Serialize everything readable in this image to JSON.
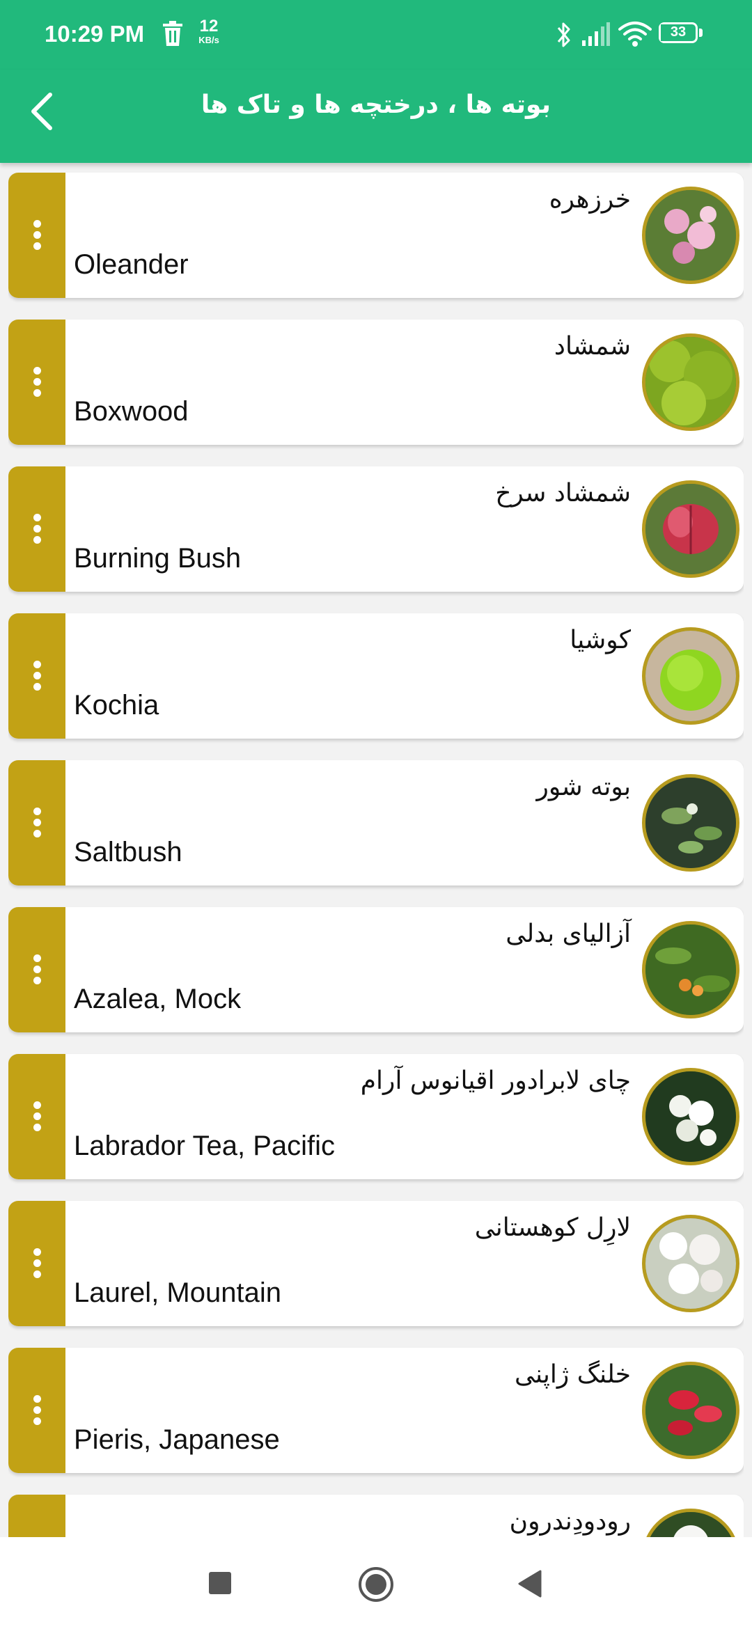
{
  "status": {
    "time": "10:29 PM",
    "netspeed_value": "12",
    "netspeed_unit": "KB/s",
    "battery": "33",
    "battery_fraction": 0.33
  },
  "header": {
    "title": "بوته ها ، درختچه ها و تاک ها",
    "back_icon": "chevron-left-icon"
  },
  "colors": {
    "primary": "#21b97c",
    "menu_strip": "#c2a215",
    "thumb_border": "#b79b1f"
  },
  "items": [
    {
      "fa": "خرزهره",
      "en": "Oleander"
    },
    {
      "fa": "شمشاد",
      "en": "Boxwood"
    },
    {
      "fa": "شمشاد سرخ",
      "en": "Burning Bush"
    },
    {
      "fa": "کوشیا",
      "en": "Kochia"
    },
    {
      "fa": "بوته شور",
      "en": "Saltbush"
    },
    {
      "fa": "آزالیای بدلی",
      "en": "Azalea, Mock"
    },
    {
      "fa": "چای لابرادور اقیانوس آرام",
      "en": "Labrador Tea, Pacific"
    },
    {
      "fa": "لارِل کوهستانی",
      "en": "Laurel, Mountain"
    },
    {
      "fa": "خلنگ ژاپنی",
      "en": "Pieris, Japanese"
    },
    {
      "fa": "رودودِندرون",
      "en": ""
    }
  ],
  "navbar": {
    "icons": [
      "recents-square-icon",
      "home-circle-icon",
      "back-triangle-icon"
    ]
  }
}
